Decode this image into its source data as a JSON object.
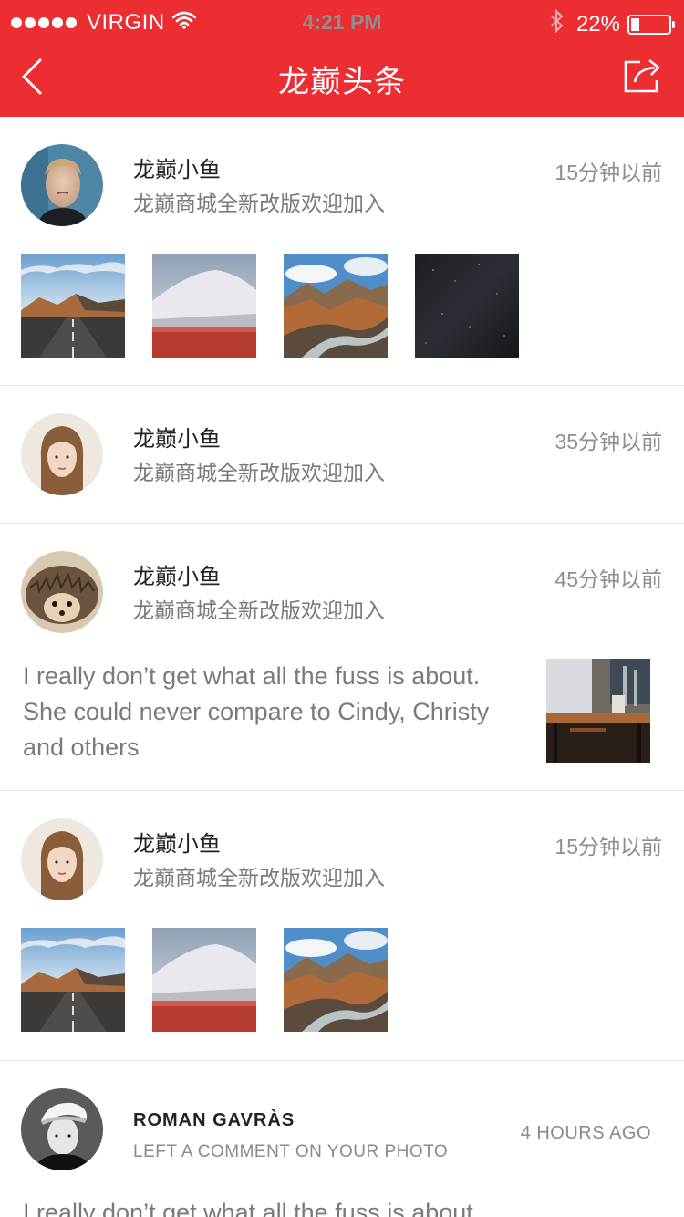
{
  "status": {
    "carrier": "VIRGIN",
    "time": "4:21 PM",
    "battery": "22%",
    "battery_level": 0.22
  },
  "nav": {
    "title": "龙巅头条",
    "back_icon": "chevron-left-icon",
    "share_icon": "share-icon"
  },
  "colors": {
    "accent": "#ec2e33",
    "text_primary": "#222222",
    "text_secondary": "#7a7a7a"
  },
  "feed": [
    {
      "name": "龙巅小鱼",
      "subtitle": "龙巅商城全新改版欢迎加入",
      "time": "15分钟以前",
      "avatar": "man-portrait",
      "images": [
        "desert-road",
        "snow-mountain",
        "mountain-river",
        "night-sky"
      ]
    },
    {
      "name": "龙巅小鱼",
      "subtitle": "龙巅商城全新改版欢迎加入",
      "time": "35分钟以前",
      "avatar": "woman-portrait"
    },
    {
      "name": "龙巅小鱼",
      "subtitle": "龙巅商城全新改版欢迎加入",
      "time": "45分钟以前",
      "avatar": "hedgehog",
      "text": "I really don’t get what all the fuss is about. She could never compare to Cindy, Christy and others",
      "side_image": "restaurant-table"
    },
    {
      "name": "龙巅小鱼",
      "subtitle": "龙巅商城全新改版欢迎加入",
      "time": "15分钟以前",
      "avatar": "woman-portrait",
      "images": [
        "desert-road",
        "snow-mountain",
        "mountain-river"
      ]
    },
    {
      "name": "ROMAN GAVRÀS",
      "subtitle": "LEFT A COMMENT ON YOUR PHOTO",
      "time": "4 HOURS AGO",
      "avatar": "man-cap-portrait",
      "text": "I really don’t get what all the fuss is about."
    }
  ]
}
